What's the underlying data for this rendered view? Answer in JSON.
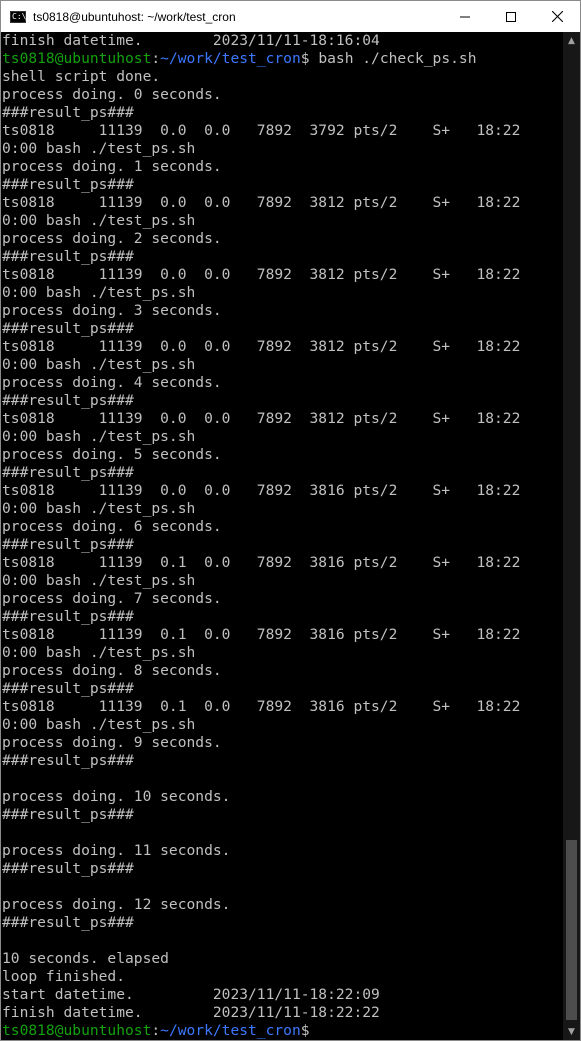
{
  "window": {
    "title": "ts0818@ubuntuhost: ~/work/test_cron",
    "icon_label": "C:\\",
    "controls": {
      "minimize": "minimize-icon",
      "maximize": "maximize-icon",
      "close": "close-icon"
    }
  },
  "colors": {
    "background": "#000000",
    "text": "#c0c0c0",
    "prompt_user": "#13a10e",
    "prompt_path": "#3b78ff"
  },
  "lines": [
    "finish datetime.        2023/11/11-18:16:04",
    {
      "user": "ts0818@ubuntuhost",
      "sep": ":",
      "path": "~/work/test_cron",
      "cmd": "$ bash ./check_ps.sh"
    },
    "shell script done.",
    "process doing. 0 seconds.",
    "###result_ps###",
    "ts0818     11139  0.0  0.0   7892  3792 pts/2    S+   18:22",
    "0:00 bash ./test_ps.sh",
    "process doing. 1 seconds.",
    "###result_ps###",
    "ts0818     11139  0.0  0.0   7892  3812 pts/2    S+   18:22",
    "0:00 bash ./test_ps.sh",
    "process doing. 2 seconds.",
    "###result_ps###",
    "ts0818     11139  0.0  0.0   7892  3812 pts/2    S+   18:22",
    "0:00 bash ./test_ps.sh",
    "process doing. 3 seconds.",
    "###result_ps###",
    "ts0818     11139  0.0  0.0   7892  3812 pts/2    S+   18:22",
    "0:00 bash ./test_ps.sh",
    "process doing. 4 seconds.",
    "###result_ps###",
    "ts0818     11139  0.0  0.0   7892  3812 pts/2    S+   18:22",
    "0:00 bash ./test_ps.sh",
    "process doing. 5 seconds.",
    "###result_ps###",
    "ts0818     11139  0.0  0.0   7892  3816 pts/2    S+   18:22",
    "0:00 bash ./test_ps.sh",
    "process doing. 6 seconds.",
    "###result_ps###",
    "ts0818     11139  0.1  0.0   7892  3816 pts/2    S+   18:22",
    "0:00 bash ./test_ps.sh",
    "process doing. 7 seconds.",
    "###result_ps###",
    "ts0818     11139  0.1  0.0   7892  3816 pts/2    S+   18:22",
    "0:00 bash ./test_ps.sh",
    "process doing. 8 seconds.",
    "###result_ps###",
    "ts0818     11139  0.1  0.0   7892  3816 pts/2    S+   18:22",
    "0:00 bash ./test_ps.sh",
    "process doing. 9 seconds.",
    "###result_ps###",
    "",
    "process doing. 10 seconds.",
    "###result_ps###",
    "",
    "process doing. 11 seconds.",
    "###result_ps###",
    "",
    "process doing. 12 seconds.",
    "###result_ps###",
    "",
    "10 seconds. elapsed",
    "loop finished.",
    "start datetime.         2023/11/11-18:22:09",
    "finish datetime.        2023/11/11-18:22:22",
    {
      "user": "ts0818@ubuntuhost",
      "sep": ":",
      "path": "~/work/test_cron",
      "cmd": "$"
    }
  ]
}
